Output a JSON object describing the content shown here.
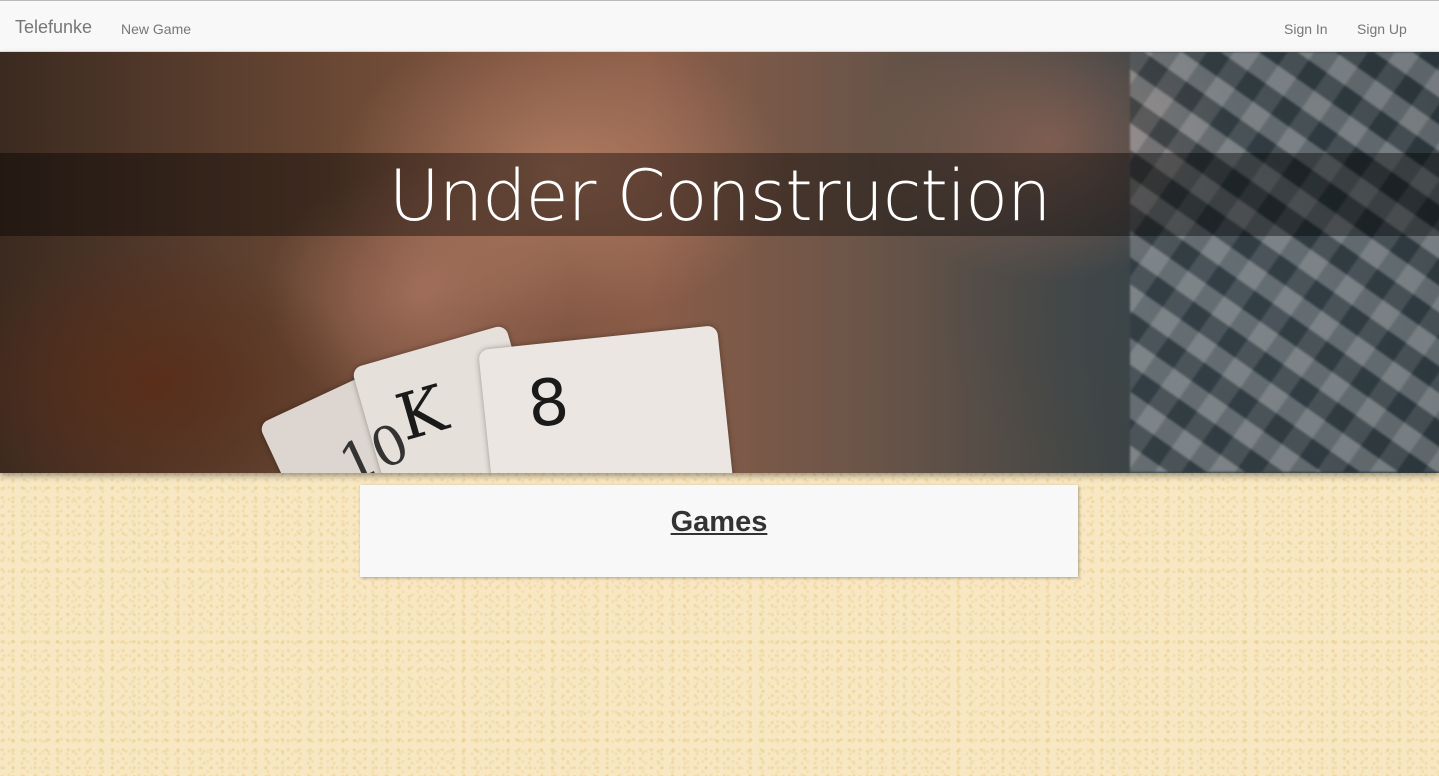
{
  "navbar": {
    "brand": "Telefunke",
    "left_items": [
      {
        "label": "New Game"
      }
    ],
    "right_items": [
      {
        "label": "Sign In"
      },
      {
        "label": "Sign Up"
      }
    ]
  },
  "hero": {
    "title": "Under Construction",
    "card_glyphs": {
      "ten": "10",
      "king": "K",
      "eight": "8",
      "spade": "♠"
    }
  },
  "games_panel": {
    "title": "Games"
  },
  "colors": {
    "page_background": "#f7e7c3",
    "navbar_background": "#f8f8f8",
    "nav_text": "#777777",
    "hero_title": "#ffffff",
    "panel_title": "#333333"
  }
}
